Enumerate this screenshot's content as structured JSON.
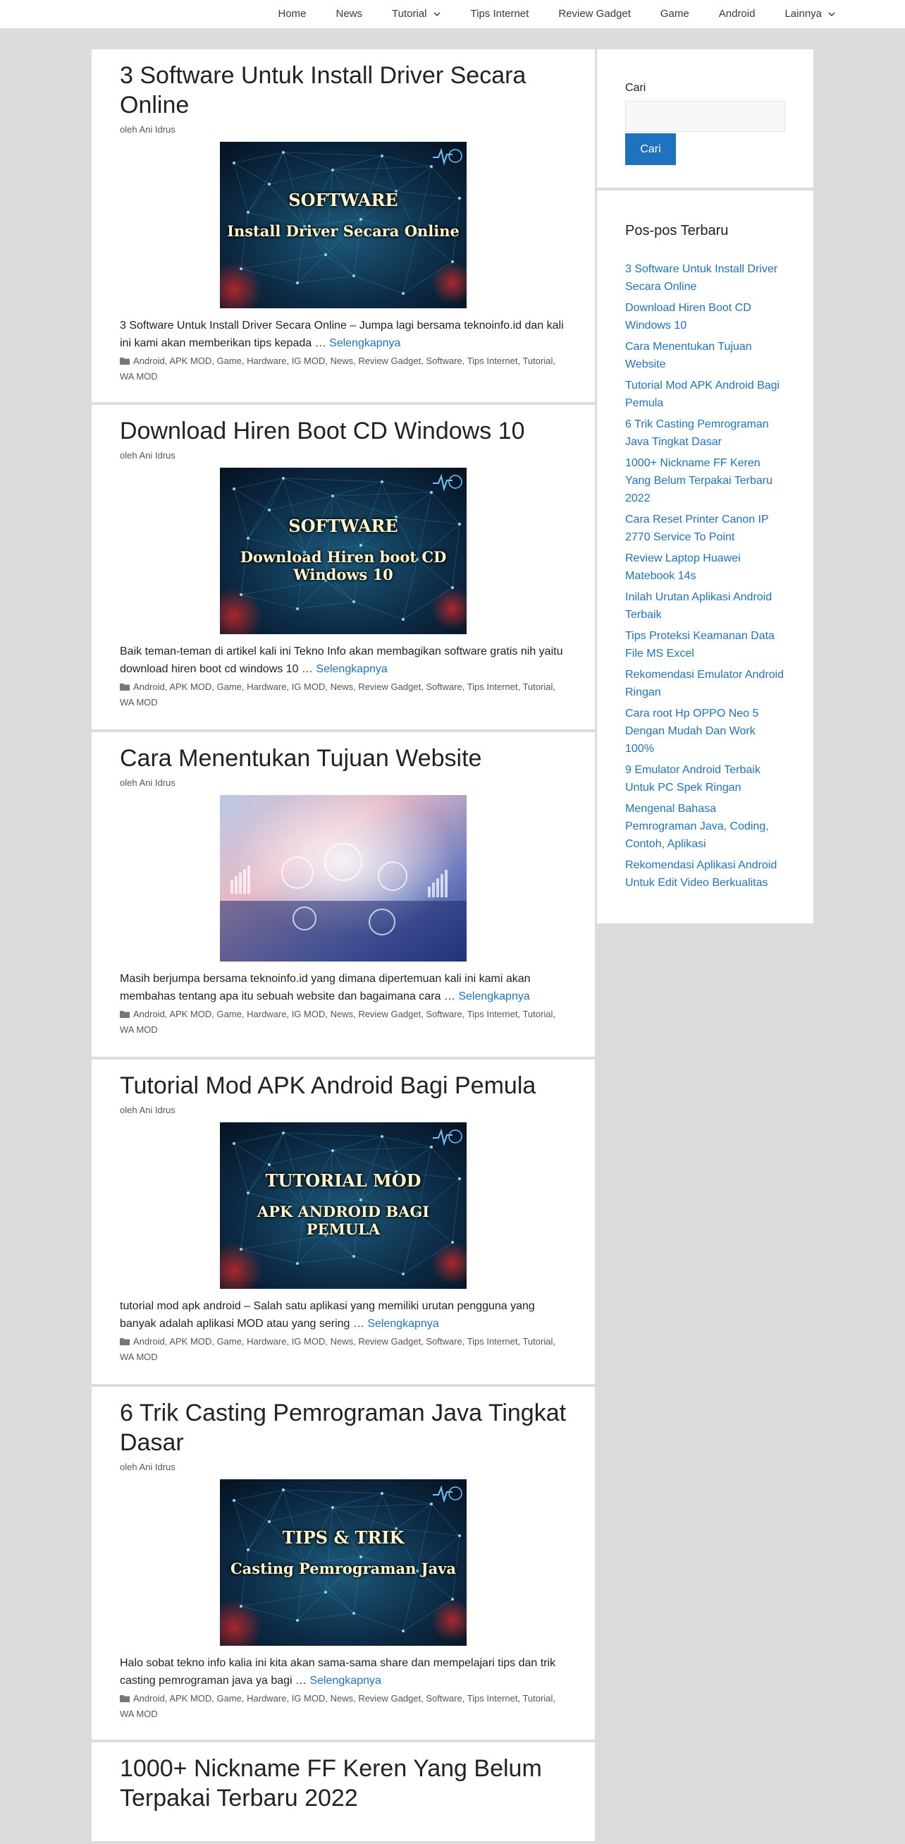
{
  "nav": {
    "items": [
      {
        "label": "Home",
        "dropdown": false
      },
      {
        "label": "News",
        "dropdown": false
      },
      {
        "label": "Tutorial",
        "dropdown": true
      },
      {
        "label": "Tips Internet",
        "dropdown": false
      },
      {
        "label": "Review Gadget",
        "dropdown": false
      },
      {
        "label": "Game",
        "dropdown": false
      },
      {
        "label": "Android",
        "dropdown": false
      },
      {
        "label": "Lainnya",
        "dropdown": true
      }
    ]
  },
  "byline_prefix": "oleh",
  "read_more": "Selengkapnya",
  "articles": [
    {
      "title": "3 Software Untuk Install Driver Secara Online",
      "author": "Ani Idrus",
      "thumb": {
        "style": "network",
        "line1": "SOFTWARE",
        "line2": "Install Driver Secara Online"
      },
      "excerpt": "3 Software Untuk Install Driver Secara Online – Jumpa lagi bersama teknoinfo.id dan kali ini kami akan memberikan tips kepada …",
      "categories": "Android, APK MOD, Game, Hardware, IG MOD, News, Review Gadget, Software, Tips Internet, Tutorial, WA MOD"
    },
    {
      "title": "Download Hiren Boot CD Windows 10",
      "author": "Ani Idrus",
      "thumb": {
        "style": "network",
        "line1": "SOFTWARE",
        "line2": "Download Hiren boot CD Windows 10"
      },
      "excerpt": "Baik teman-teman di artikel kali ini Tekno Info akan membagikan software gratis nih yaitu download hiren boot cd windows 10 …",
      "categories": "Android, APK MOD, Game, Hardware, IG MOD, News, Review Gadget, Software, Tips Internet, Tutorial, WA MOD"
    },
    {
      "title": "Cara Menentukan Tujuan Website",
      "author": "Ani Idrus",
      "thumb": {
        "style": "photo",
        "line1": "",
        "line2": ""
      },
      "excerpt": "Masih berjumpa bersama teknoinfo.id yang dimana dipertemuan kali ini kami akan membahas tentang apa itu sebuah website dan bagaimana cara …",
      "categories": "Android, APK MOD, Game, Hardware, IG MOD, News, Review Gadget, Software, Tips Internet, Tutorial, WA MOD"
    },
    {
      "title": "Tutorial Mod APK Android Bagi Pemula",
      "author": "Ani Idrus",
      "thumb": {
        "style": "network",
        "line1": "TUTORIAL MOD",
        "line2": "APK ANDROID BAGI PEMULA"
      },
      "excerpt": "tutorial mod apk android – Salah satu aplikasi yang memiliki urutan pengguna yang banyak adalah aplikasi MOD atau yang sering …",
      "categories": "Android, APK MOD, Game, Hardware, IG MOD, News, Review Gadget, Software, Tips Internet, Tutorial, WA MOD"
    },
    {
      "title": "6 Trik Casting Pemrograman Java Tingkat Dasar",
      "author": "Ani Idrus",
      "thumb": {
        "style": "network",
        "line1": "TIPS & TRIK",
        "line2": "Casting Pemrograman Java"
      },
      "excerpt": "Halo sobat tekno info kalia ini kita akan sama-sama share dan mempelajari tips dan trik casting pemrograman java ya bagi …",
      "categories": "Android, APK MOD, Game, Hardware, IG MOD, News, Review Gadget, Software, Tips Internet, Tutorial, WA MOD"
    },
    {
      "title": "1000+ Nickname FF Keren Yang Belum Terpakai Terbaru 2022",
      "author": "",
      "thumb": null,
      "excerpt": "",
      "categories": ""
    }
  ],
  "search": {
    "label": "Cari",
    "button": "Cari",
    "placeholder": ""
  },
  "recent": {
    "title": "Pos-pos Terbaru",
    "items": [
      "3 Software Untuk Install Driver Secara Online",
      "Download Hiren Boot CD Windows 10",
      "Cara Menentukan Tujuan Website",
      "Tutorial Mod APK Android Bagi Pemula",
      "6 Trik Casting Pemrograman Java Tingkat Dasar",
      "1000+ Nickname FF Keren Yang Belum Terpakai Terbaru 2022",
      "Cara Reset Printer Canon IP 2770 Service To Point",
      "Review Laptop Huawei Matebook 14s",
      "Inilah Urutan Aplikasi Android Terbaik",
      "Tips Proteksi Keamanan Data File MS Excel",
      "Rekomendasi Emulator Android Ringan",
      "Cara root Hp OPPO Neo 5 Dengan Mudah Dan Work 100%",
      "9 Emulator Android Terbaik Untuk PC Spek Ringan",
      "Mengenal Bahasa Pemrograman Java, Coding, Contoh, Aplikasi",
      "Rekomendasi Aplikasi Android Untuk Edit Video Berkualitas"
    ]
  },
  "colors": {
    "link": "#1e73be",
    "background": "#dcdcda",
    "button": "#1e73be"
  }
}
